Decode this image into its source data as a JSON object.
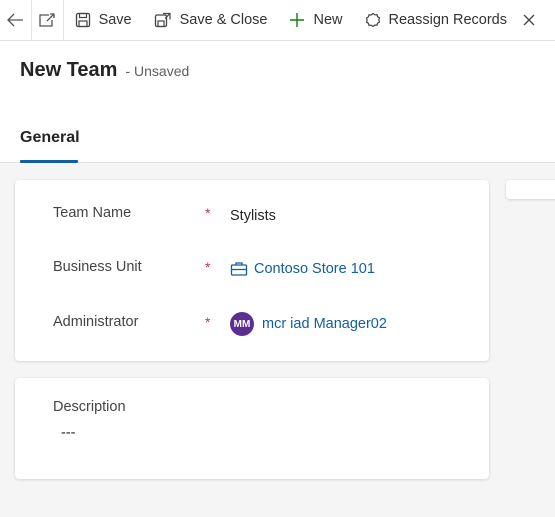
{
  "toolbar": {
    "save_label": "Save",
    "save_close_label": "Save & Close",
    "new_label": "New",
    "reassign_label": "Reassign Records"
  },
  "header": {
    "title": "New Team",
    "status": "- Unsaved",
    "tabs": [
      {
        "label": "General"
      }
    ]
  },
  "form": {
    "team_name": {
      "label": "Team Name",
      "required": "*",
      "value": "Stylists"
    },
    "business_unit": {
      "label": "Business Unit",
      "required": "*",
      "value": "Contoso Store 101",
      "icon": "business-unit-icon"
    },
    "administrator": {
      "label": "Administrator",
      "required": "*",
      "value": "mcr iad Manager02",
      "avatar_initials": "MM"
    },
    "description": {
      "label": "Description",
      "value": "---"
    }
  },
  "colors": {
    "accent": "#115ea3",
    "required": "#c4314b",
    "avatar": "#5c2e91"
  }
}
